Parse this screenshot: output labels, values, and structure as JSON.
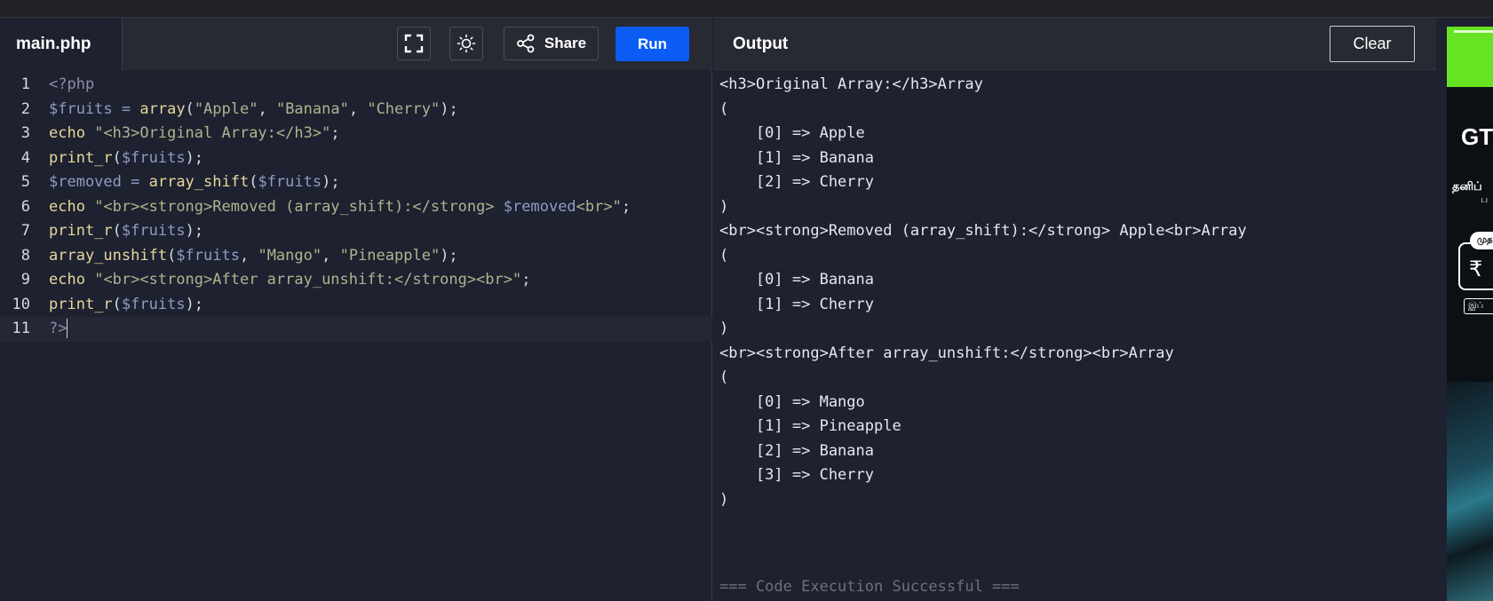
{
  "editor": {
    "filename": "main.php",
    "toolbar": {
      "fullscreen_icon": "fullscreen-icon",
      "theme_icon": "sun-icon",
      "share_icon": "share-icon",
      "share_label": "Share",
      "run_label": "Run"
    },
    "line_numbers": [
      "1",
      "2",
      "3",
      "4",
      "5",
      "6",
      "7",
      "8",
      "9",
      "10",
      "11"
    ],
    "code": [
      [
        [
          "tag",
          "<?php"
        ]
      ],
      [
        [
          "var",
          "$fruits"
        ],
        [
          "op",
          " = "
        ],
        [
          "fn",
          "array"
        ],
        [
          "pn",
          "("
        ],
        [
          "str",
          "\"Apple\""
        ],
        [
          "pn",
          ", "
        ],
        [
          "str",
          "\"Banana\""
        ],
        [
          "pn",
          ", "
        ],
        [
          "str",
          "\"Cherry\""
        ],
        [
          "pn",
          ");"
        ]
      ],
      [
        [
          "fn",
          "echo"
        ],
        [
          "pn",
          " "
        ],
        [
          "str",
          "\"<h3>Original Array:</h3>\""
        ],
        [
          "pn",
          ";"
        ]
      ],
      [
        [
          "fn",
          "print_r"
        ],
        [
          "pn",
          "("
        ],
        [
          "var",
          "$fruits"
        ],
        [
          "pn",
          ");"
        ]
      ],
      [
        [
          "var",
          "$removed"
        ],
        [
          "op",
          " = "
        ],
        [
          "fn",
          "array_shift"
        ],
        [
          "pn",
          "("
        ],
        [
          "var",
          "$fruits"
        ],
        [
          "pn",
          ");"
        ]
      ],
      [
        [
          "fn",
          "echo"
        ],
        [
          "pn",
          " "
        ],
        [
          "str",
          "\"<br><strong>Removed (array_shift):</strong> "
        ],
        [
          "var",
          "$removed"
        ],
        [
          "str",
          "<br>\""
        ],
        [
          "pn",
          ";"
        ]
      ],
      [
        [
          "fn",
          "print_r"
        ],
        [
          "pn",
          "("
        ],
        [
          "var",
          "$fruits"
        ],
        [
          "pn",
          ");"
        ]
      ],
      [
        [
          "fn",
          "array_unshift"
        ],
        [
          "pn",
          "("
        ],
        [
          "var",
          "$fruits"
        ],
        [
          "pn",
          ", "
        ],
        [
          "str",
          "\"Mango\""
        ],
        [
          "pn",
          ", "
        ],
        [
          "str",
          "\"Pineapple\""
        ],
        [
          "pn",
          ");"
        ]
      ],
      [
        [
          "fn",
          "echo"
        ],
        [
          "pn",
          " "
        ],
        [
          "str",
          "\"<br><strong>After array_unshift:</strong><br>\""
        ],
        [
          "pn",
          ";"
        ]
      ],
      [
        [
          "fn",
          "print_r"
        ],
        [
          "pn",
          "("
        ],
        [
          "var",
          "$fruits"
        ],
        [
          "pn",
          ");"
        ]
      ],
      [
        [
          "tag",
          "?>"
        ]
      ]
    ]
  },
  "output": {
    "title": "Output",
    "clear_label": "Clear",
    "lines": [
      "<h3>Original Array:</h3>Array",
      "(",
      "    [0] => Apple",
      "    [1] => Banana",
      "    [2] => Cherry",
      ")",
      "<br><strong>Removed (array_shift):</strong> Apple<br>Array",
      "(",
      "    [0] => Banana",
      "    [1] => Cherry",
      ")",
      "<br><strong>After array_unshift:</strong><br>Array",
      "(",
      "    [0] => Mango",
      "    [1] => Pineapple",
      "    [2] => Banana",
      "    [3] => Cherry",
      ")"
    ],
    "status": "=== Code Execution Successful ==="
  },
  "ad": {
    "logo": "GT",
    "tamil_line1": "தனிப்",
    "tamil_line2": "ப",
    "pill_text": "முத",
    "price_symbol": "₹",
    "small_text": "இப்"
  }
}
